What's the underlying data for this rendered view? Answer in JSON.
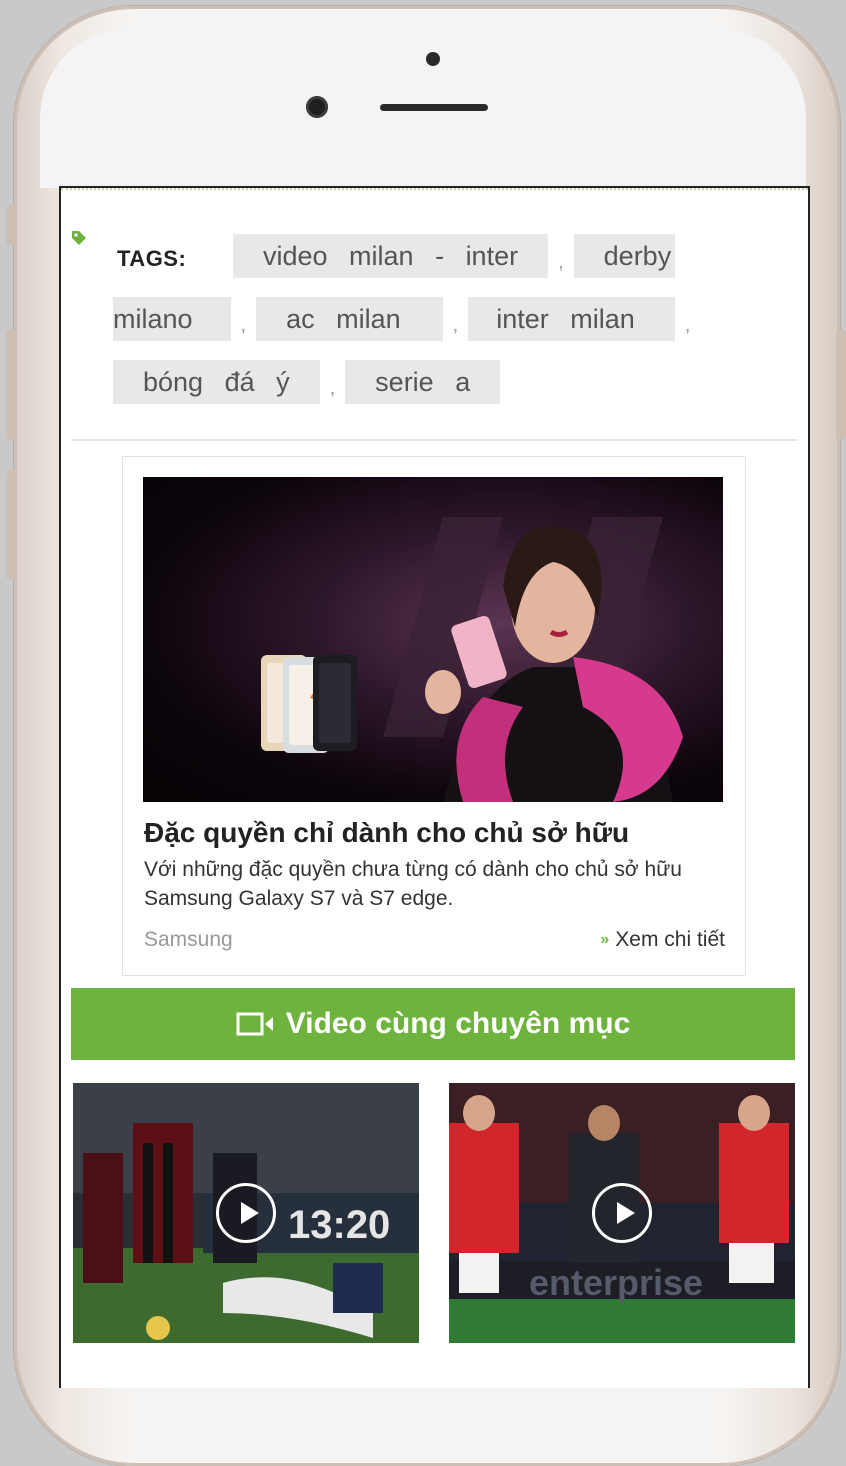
{
  "tags": {
    "label": "TAGS:",
    "separator": ",",
    "items": [
      "video milan - inter",
      "derby milano",
      "ac milan",
      "inter milan",
      "bóng đá ý",
      "serie a"
    ],
    "row1": [
      "video milan - inter",
      "derby"
    ],
    "row2": [
      "milano",
      "ac milan",
      "inter milan"
    ],
    "row3": [
      "bóng đá ý",
      "serie a"
    ]
  },
  "ad": {
    "title": "Đặc quyền chỉ dành cho chủ sở hữu",
    "description": "Với những đặc quyền chưa từng có dành cho chủ sở hữu Samsung Galaxy S7 và S7 edge.",
    "source": "Samsung",
    "more_label": "Xem chi tiết",
    "more_icon": "double-chevron-right-icon"
  },
  "video_section": {
    "title": "Video cùng chuyên mục",
    "icon": "video-camera-icon",
    "accent_color": "#6fb33f",
    "thumbnails": [
      {
        "overlay_text": "13:20",
        "icon": "play-icon"
      },
      {
        "overlay_text": "enterprise",
        "icon": "play-icon"
      }
    ]
  },
  "colors": {
    "tag_background": "#e8e8e8",
    "tag_icon": "#6fb33f"
  }
}
